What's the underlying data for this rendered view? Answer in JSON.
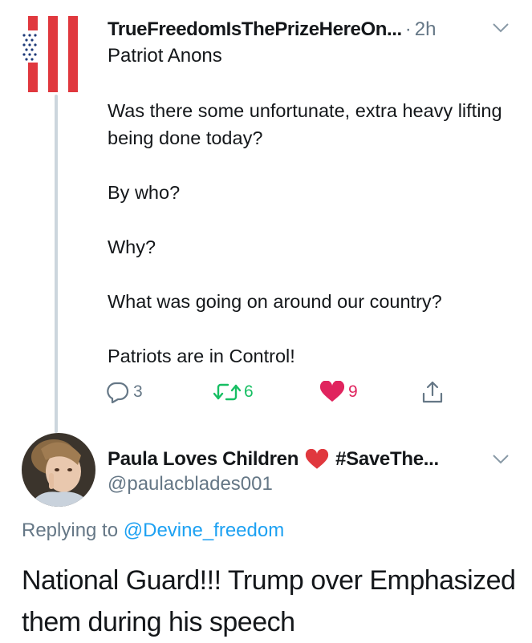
{
  "tweet1": {
    "display_name": "TrueFreedomIsThePrizeHereOn...",
    "separator": "·",
    "time": "2h",
    "handle": "Patriot Anons",
    "body": [
      "Was there some unfortunate, extra heavy lifting being done today?",
      "By who?",
      "Why?",
      "What was going on around our country?",
      "Patriots are in Control!"
    ],
    "actions": {
      "replies": "3",
      "retweets": "6",
      "likes": "9"
    }
  },
  "tweet2": {
    "display_name": "Paula Loves Children",
    "hashtag": "#SaveThe...",
    "handle": "@paulacblades001",
    "replying_prefix": "Replying to",
    "replying_handle": "@Devine_freedom",
    "body": "National Guard!!! Trump over Emphasized them during his speech"
  },
  "icons": {
    "avatar1": "american-flag-avatar",
    "caret": "chevron-down-icon",
    "reply": "reply-icon",
    "retweet": "retweet-icon",
    "like": "heart-icon",
    "share": "share-icon",
    "name_emoji": "red-heart-emoji",
    "avatar2": "child-photo-avatar"
  },
  "colors": {
    "text": "#14171a",
    "muted": "#657786",
    "link": "#1da1f2",
    "retweet": "#17bf63",
    "like": "#e0245e",
    "thread_line": "#ccd6dd",
    "flag_red": "#e0383e",
    "flag_blue": "#1f3b7a"
  }
}
